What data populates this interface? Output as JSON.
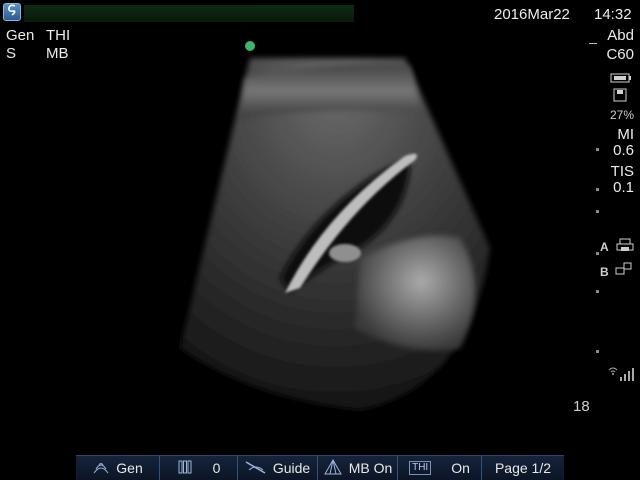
{
  "header": {
    "mode_left_top": "Gen",
    "mode_left_top2": "THI",
    "mode_left_bottom": "S",
    "mode_left_bottom2": "MB",
    "date": "2016Mar22",
    "time": "14:32"
  },
  "right_panel": {
    "exam": "Abd",
    "probe": "C60",
    "storage_percent": "27%",
    "mi_label": "MI",
    "mi_value": "0.6",
    "tis_label": "TIS",
    "tis_value": "0.1",
    "marker_a": "A",
    "marker_b": "B"
  },
  "image": {
    "depth_value": "18"
  },
  "toolbar": {
    "items": [
      {
        "label": "Gen",
        "icon": "probe-icon"
      },
      {
        "label": "0",
        "icon": "bars-icon"
      },
      {
        "label": "Guide",
        "icon": "needle-guide-icon"
      },
      {
        "label": "MB On",
        "icon": "mb-icon"
      },
      {
        "label": "On",
        "icon": "thi-icon",
        "badge": "THI"
      },
      {
        "label": "Page 1/2"
      }
    ]
  },
  "colors": {
    "toolbar_bg": "#12203a",
    "accent_green": "#3fb46a"
  }
}
